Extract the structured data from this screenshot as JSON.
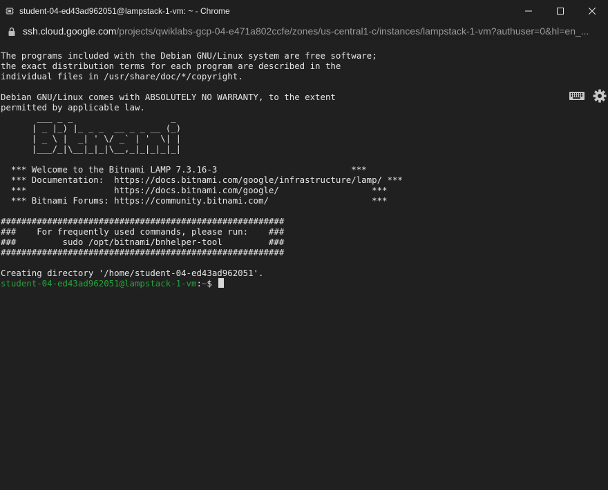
{
  "window": {
    "title": "student-04-ed43ad962051@lampstack-1-vm: ~ - Chrome",
    "app_icon": "ssh-app-icon",
    "controls": [
      "minimize-icon",
      "maximize-icon",
      "close-icon"
    ]
  },
  "address_bar": {
    "lock_icon": "lock-icon",
    "host": "ssh.cloud.google.com",
    "path": "/projects/qwiklabs-gcp-04-e471a802ccfe/zones/us-central1-c/instances/lampstack-1-vm?authuser=0&hl=en_..."
  },
  "toolbar": {
    "keyboard_icon": "keyboard-icon",
    "settings_icon": "gear-icon"
  },
  "terminal": {
    "output": [
      "The programs included with the Debian GNU/Linux system are free software;",
      "the exact distribution terms for each program are described in the",
      "individual files in /usr/share/doc/*/copyright.",
      "",
      "Debian GNU/Linux comes with ABSOLUTELY NO WARRANTY, to the extent",
      "permitted by applicable law.",
      "       ___ _ _                   _",
      "      | _ |_) |_ _ _  __ _ _ __ (_)",
      "      | _ \\ |  _| ' \\/ _` | '  \\| |",
      "      |___/_|\\__|_|_|\\__,_|_|_|_|_|",
      "",
      "  *** Welcome to the Bitnami LAMP 7.3.16-3                          ***",
      "  *** Documentation:  https://docs.bitnami.com/google/infrastructure/lamp/ ***",
      "  ***                 https://docs.bitnami.com/google/                  ***",
      "  *** Bitnami Forums: https://community.bitnami.com/                    ***",
      "",
      "#######################################################",
      "###    For frequently used commands, please run:    ###",
      "###         sudo /opt/bitnami/bnhelper-tool         ###",
      "#######################################################",
      "",
      "Creating directory '/home/student-04-ed43ad962051'."
    ],
    "prompt": {
      "user_host": "student-04-ed43ad962051@lampstack-1-vm",
      "separator": ":",
      "path": "~",
      "symbol": "$ "
    },
    "colors": {
      "background": "#202020",
      "text": "#e6e6e6",
      "prompt_user": "#26a33c",
      "prompt_path": "#4d7fd9"
    }
  }
}
